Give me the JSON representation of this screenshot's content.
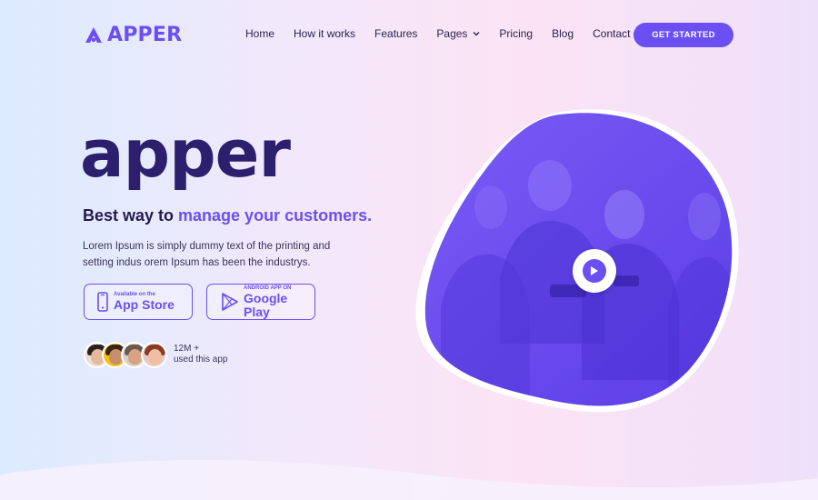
{
  "brand": {
    "name": "APPER",
    "color": "#6b4ff2"
  },
  "nav": {
    "items": [
      {
        "label": "Home"
      },
      {
        "label": "How it works"
      },
      {
        "label": "Features"
      },
      {
        "label": "Pages",
        "has_dropdown": true
      },
      {
        "label": "Pricing"
      },
      {
        "label": "Blog"
      },
      {
        "label": "Contact"
      }
    ],
    "cta_label": "GET STARTED"
  },
  "hero": {
    "title": "apper",
    "tagline_plain": "Best way to ",
    "tagline_accent": "manage your customers.",
    "description": "Lorem Ipsum is simply dummy text of the printing and setting indus orem Ipsum has been the industrys."
  },
  "stores": {
    "app_store": {
      "small": "Available on the",
      "big": "App Store",
      "icon": "phone-icon"
    },
    "google_play": {
      "small": "ANDROID APP ON",
      "big": "Google Play",
      "icon": "google-play-icon"
    }
  },
  "social_proof": {
    "count": "12M +",
    "text": "used this app",
    "avatars": [
      "user-avatar",
      "user-avatar",
      "user-avatar",
      "user-avatar"
    ]
  },
  "media": {
    "icon": "play-icon"
  },
  "colors": {
    "accent": "#6b4ff2",
    "title": "#2c1f6d",
    "text": "#231a4d"
  }
}
